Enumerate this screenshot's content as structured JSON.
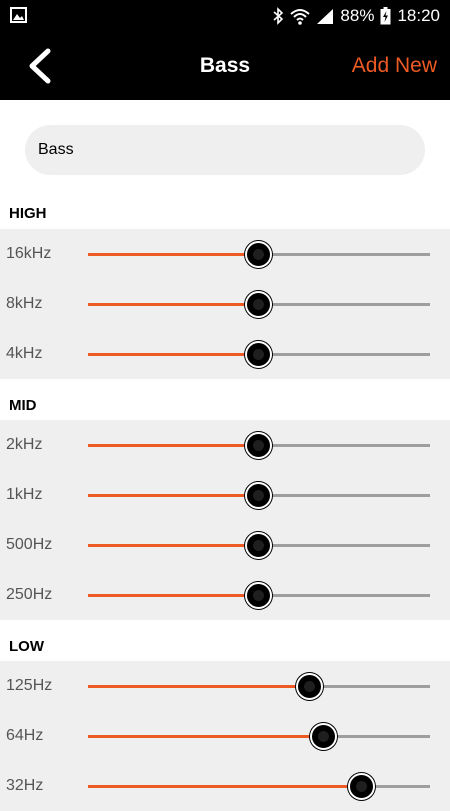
{
  "status_bar": {
    "battery": "88%",
    "time": "18:20",
    "icons": [
      "image-icon",
      "bluetooth-icon",
      "wifi-icon",
      "signal-icon",
      "battery-icon"
    ]
  },
  "header": {
    "title": "Bass",
    "add_new_label": "Add New",
    "accent_color": "#ee5a24"
  },
  "preset_name": {
    "value": "Bass"
  },
  "sections": [
    {
      "title": "HIGH",
      "bands": [
        {
          "label": "16kHz",
          "level": 0.5
        },
        {
          "label": "8kHz",
          "level": 0.5
        },
        {
          "label": "4kHz",
          "level": 0.5
        }
      ]
    },
    {
      "title": "MID",
      "bands": [
        {
          "label": "2kHz",
          "level": 0.5
        },
        {
          "label": "1kHz",
          "level": 0.5
        },
        {
          "label": "500Hz",
          "level": 0.5
        },
        {
          "label": "250Hz",
          "level": 0.5
        }
      ]
    },
    {
      "title": "LOW",
      "bands": [
        {
          "label": "125Hz",
          "level": 0.65
        },
        {
          "label": "64Hz",
          "level": 0.69
        },
        {
          "label": "32Hz",
          "level": 0.8
        }
      ]
    }
  ]
}
